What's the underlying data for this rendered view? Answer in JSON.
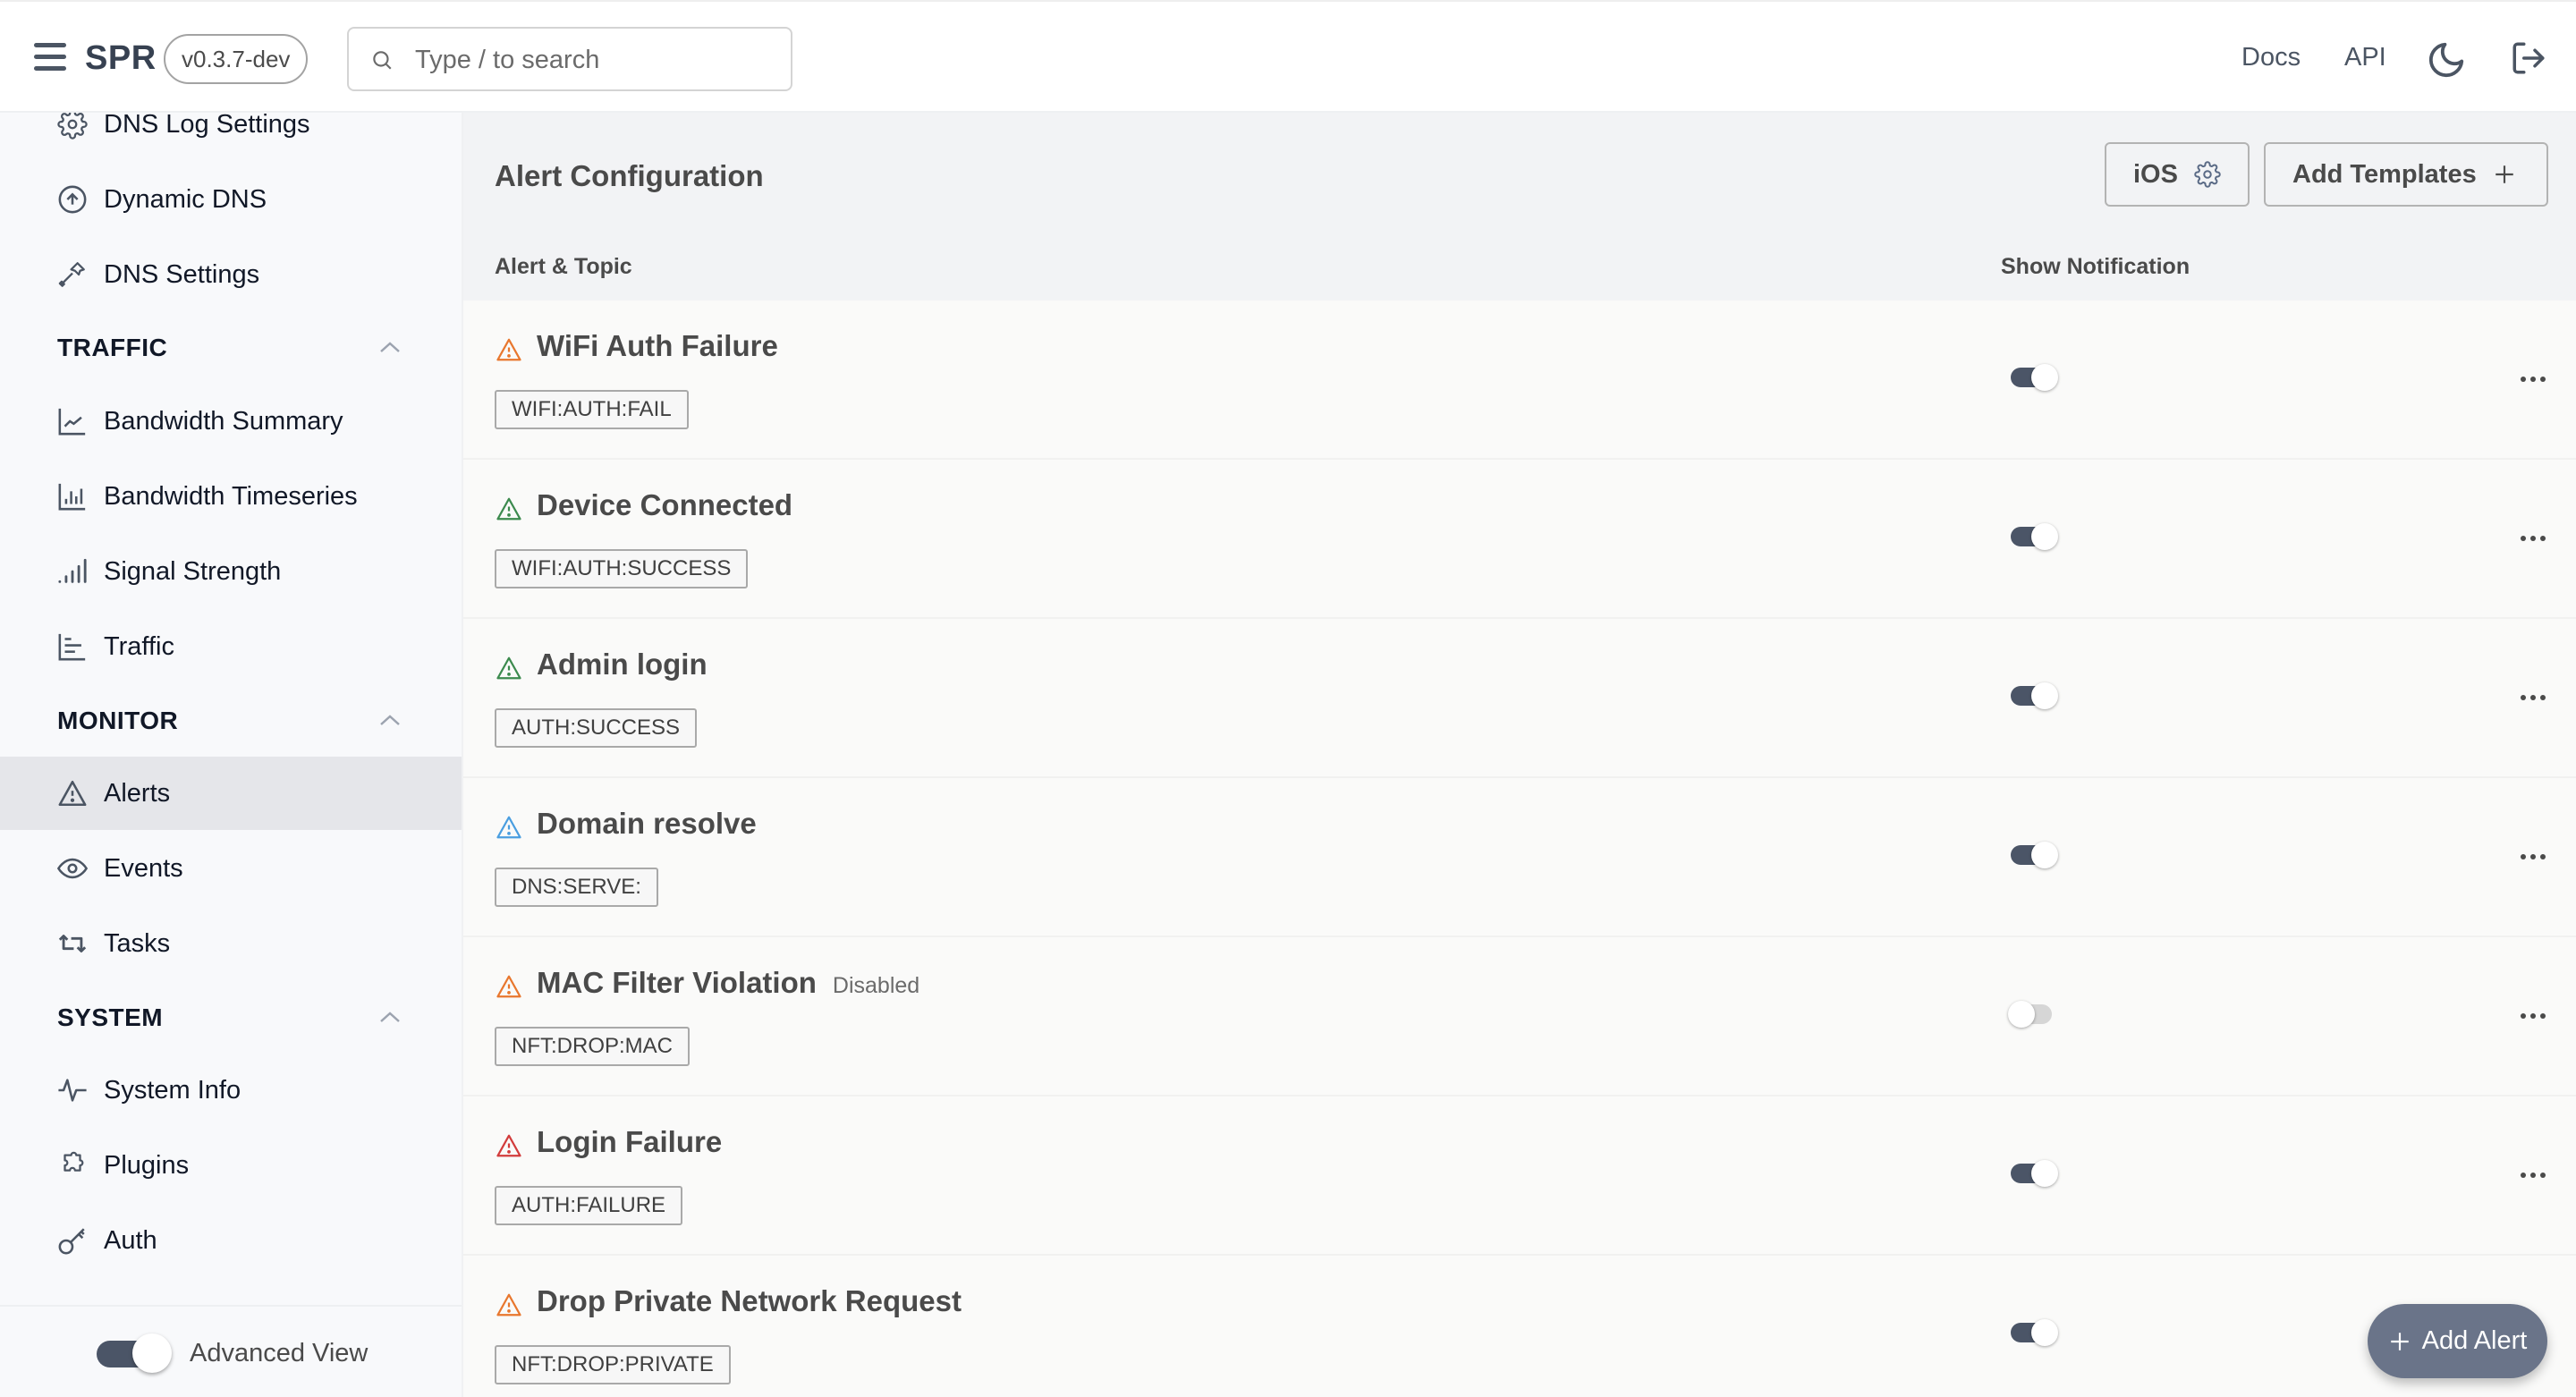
{
  "header": {
    "brand": "SPR",
    "version": "v0.3.7-dev",
    "search_placeholder": "Type / to search",
    "search_value": "",
    "links": {
      "docs": "Docs",
      "api": "API"
    },
    "icons": {
      "menu": "hamburger-icon",
      "search": "search-icon",
      "theme": "moon-icon",
      "logout": "logout-icon"
    }
  },
  "sidebar": {
    "items_top": [
      {
        "label": "DNS Log Settings",
        "icon": "gear-icon"
      },
      {
        "label": "Dynamic DNS",
        "icon": "arrow-up-circle-icon"
      },
      {
        "label": "DNS Settings",
        "icon": "hammer-icon"
      }
    ],
    "sections": [
      {
        "title": "TRAFFIC",
        "expanded": true,
        "items": [
          {
            "label": "Bandwidth Summary",
            "icon": "line-chart-icon"
          },
          {
            "label": "Bandwidth Timeseries",
            "icon": "bar-chart-icon"
          },
          {
            "label": "Signal Strength",
            "icon": "signal-icon"
          },
          {
            "label": "Traffic",
            "icon": "horizontal-bar-chart-icon"
          }
        ]
      },
      {
        "title": "MONITOR",
        "expanded": true,
        "items": [
          {
            "label": "Alerts",
            "icon": "warning-triangle-icon",
            "active": true
          },
          {
            "label": "Events",
            "icon": "eye-icon"
          },
          {
            "label": "Tasks",
            "icon": "repeat-icon"
          }
        ]
      },
      {
        "title": "SYSTEM",
        "expanded": true,
        "items": [
          {
            "label": "System Info",
            "icon": "activity-icon"
          },
          {
            "label": "Plugins",
            "icon": "puzzle-icon"
          },
          {
            "label": "Auth",
            "icon": "key-icon"
          }
        ]
      }
    ],
    "footer": {
      "advanced_view_label": "Advanced View",
      "advanced_view_on": true
    }
  },
  "main": {
    "title": "Alert Configuration",
    "buttons": {
      "ios": "iOS",
      "add_templates": "Add Templates",
      "add_alert": "Add Alert"
    },
    "columns": {
      "alert_topic": "Alert & Topic",
      "show_notification": "Show Notification"
    },
    "alerts": [
      {
        "name": "WiFi Auth Failure",
        "topic": "WIFI:AUTH:FAIL",
        "severity_color": "#e8772e",
        "notify": true,
        "disabled": false
      },
      {
        "name": "Device Connected",
        "topic": "WIFI:AUTH:SUCCESS",
        "severity_color": "#3c8a4e",
        "notify": true,
        "disabled": false
      },
      {
        "name": "Admin login",
        "topic": "AUTH:SUCCESS",
        "severity_color": "#3c8a4e",
        "notify": true,
        "disabled": false
      },
      {
        "name": "Domain resolve",
        "topic": "DNS:SERVE:",
        "severity_color": "#4a9ee0",
        "notify": true,
        "disabled": false
      },
      {
        "name": "MAC Filter Violation",
        "topic": "NFT:DROP:MAC",
        "severity_color": "#e8772e",
        "notify": false,
        "disabled": true,
        "disabled_label": "Disabled"
      },
      {
        "name": "Login Failure",
        "topic": "AUTH:FAILURE",
        "severity_color": "#d23c3c",
        "notify": true,
        "disabled": false
      },
      {
        "name": "Drop Private Network Request",
        "topic": "NFT:DROP:PRIVATE",
        "severity_color": "#e8772e",
        "notify": true,
        "disabled": false
      }
    ]
  },
  "colors": {
    "toggle_on": "#4b5567",
    "toggle_off": "#d6d6d6",
    "fab": "#6a7489",
    "active_nav": "#e5e6ea"
  }
}
